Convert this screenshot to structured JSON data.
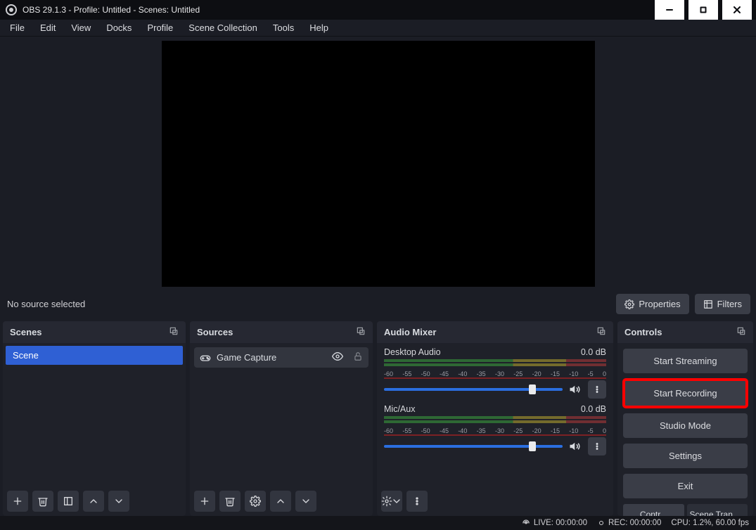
{
  "titlebar": {
    "text": "OBS 29.1.3 - Profile: Untitled - Scenes: Untitled"
  },
  "menu": [
    "File",
    "Edit",
    "View",
    "Docks",
    "Profile",
    "Scene Collection",
    "Tools",
    "Help"
  ],
  "infobar": {
    "no_source": "No source selected",
    "properties": "Properties",
    "filters": "Filters"
  },
  "docks": {
    "scenes": {
      "title": "Scenes",
      "items": [
        "Scene"
      ]
    },
    "sources": {
      "title": "Sources",
      "items": [
        {
          "label": "Game Capture"
        }
      ]
    },
    "mixer": {
      "title": "Audio Mixer",
      "ticks": [
        "-60",
        "-55",
        "-50",
        "-45",
        "-40",
        "-35",
        "-30",
        "-25",
        "-20",
        "-15",
        "-10",
        "-5",
        "0"
      ],
      "channels": [
        {
          "name": "Desktop Audio",
          "db": "0.0 dB"
        },
        {
          "name": "Mic/Aux",
          "db": "0.0 dB"
        }
      ]
    },
    "controls": {
      "title": "Controls",
      "buttons": {
        "start_streaming": "Start Streaming",
        "start_recording": "Start Recording",
        "studio_mode": "Studio Mode",
        "settings": "Settings",
        "exit": "Exit"
      },
      "tabs": {
        "controls": "Contr...",
        "transitions": "Scene Transit..."
      }
    }
  },
  "status": {
    "live": "LIVE: 00:00:00",
    "rec": "REC: 00:00:00",
    "cpu": "CPU: 1.2%, 60.00 fps"
  }
}
